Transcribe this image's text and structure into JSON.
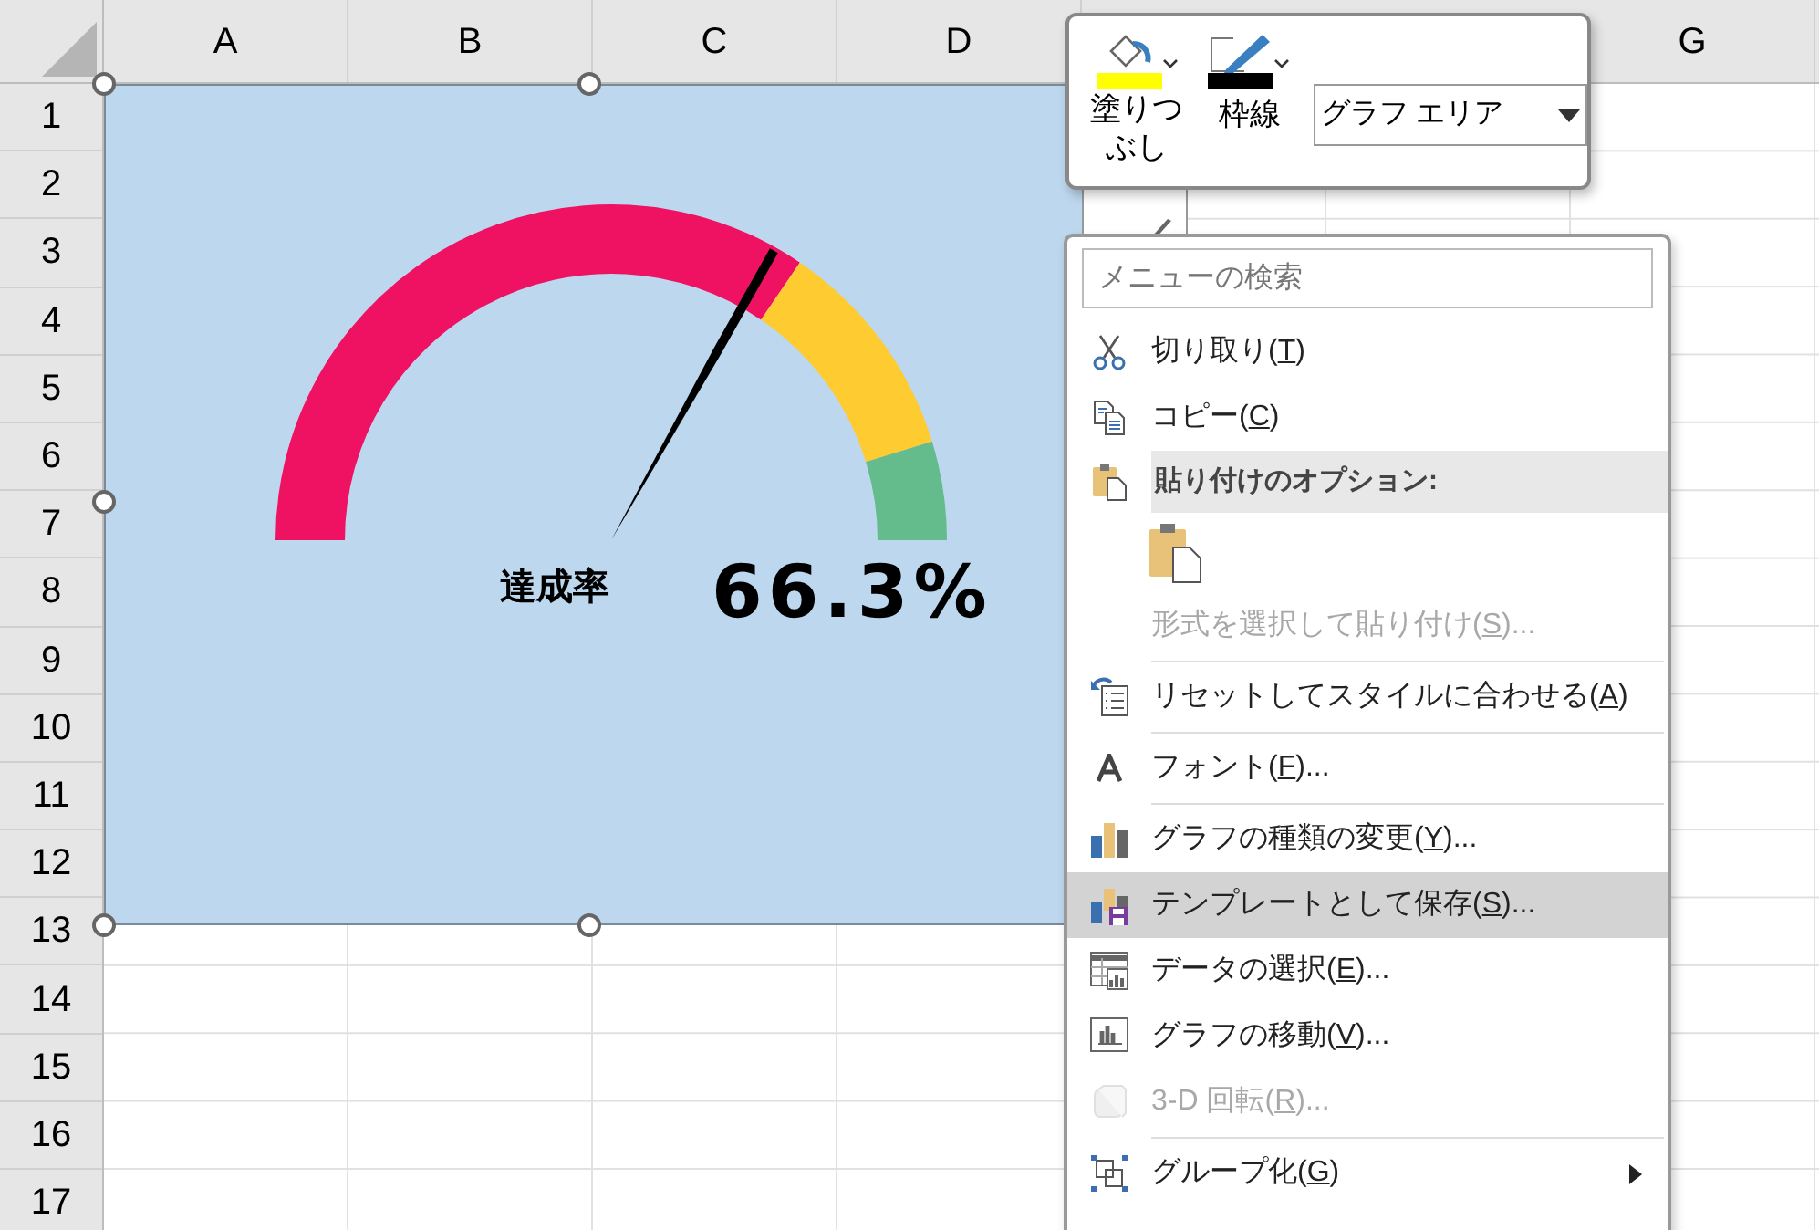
{
  "sheet": {
    "columns": [
      "A",
      "B",
      "C",
      "D",
      "G"
    ],
    "rows": [
      "1",
      "2",
      "3",
      "4",
      "5",
      "6",
      "7",
      "8",
      "9",
      "10",
      "11",
      "12",
      "13",
      "14",
      "15",
      "16",
      "17"
    ]
  },
  "chart": {
    "gauge": {
      "level": 0.663
    },
    "label": "達成率",
    "value": "66.3%"
  },
  "mini_toolbar": {
    "buttons": [
      {
        "kind": "fill",
        "label": "塗りつぶし",
        "color": "#ffff00"
      },
      {
        "kind": "outline",
        "label": "枠線",
        "color": "#000000"
      }
    ],
    "dropdown": {
      "value": "グラフ エリア"
    }
  },
  "context_menu": {
    "search": {
      "placeholder": "メニューの検索"
    },
    "items": [
      {
        "kind": "item",
        "text": "切り取り(",
        "accel": "T",
        "tail": ")",
        "disabled": false,
        "selected": false,
        "submenu": false
      },
      {
        "kind": "item",
        "text": "コピー(",
        "accel": "C",
        "tail": ")",
        "disabled": false,
        "selected": false,
        "submenu": false
      },
      {
        "kind": "header",
        "text": "貼り付けのオプション:"
      },
      {
        "kind": "paste-icons"
      },
      {
        "kind": "item",
        "text": "形式を選択して貼り付け(",
        "accel": "S",
        "tail": ")...",
        "disabled": true,
        "selected": false,
        "submenu": false
      },
      {
        "kind": "separator"
      },
      {
        "kind": "item",
        "text": "リセットしてスタイルに合わせる(",
        "accel": "A",
        "tail": ")",
        "disabled": false,
        "selected": false,
        "submenu": false
      },
      {
        "kind": "separator"
      },
      {
        "kind": "item",
        "text": "フォント(",
        "accel": "F",
        "tail": ")...",
        "disabled": false,
        "selected": false,
        "submenu": false
      },
      {
        "kind": "separator"
      },
      {
        "kind": "item",
        "text": "グラフの種類の変更(",
        "accel": "Y",
        "tail": ")...",
        "disabled": false,
        "selected": false,
        "submenu": false
      },
      {
        "kind": "item",
        "text": "テンプレートとして保存(",
        "accel": "S",
        "tail": ")...",
        "disabled": false,
        "selected": true,
        "submenu": false
      },
      {
        "kind": "item",
        "text": "データの選択(",
        "accel": "E",
        "tail": ")...",
        "disabled": false,
        "selected": false,
        "submenu": false
      },
      {
        "kind": "item",
        "text": "グラフの移動(",
        "accel": "V",
        "tail": ")...",
        "disabled": false,
        "selected": false,
        "submenu": false
      },
      {
        "kind": "item",
        "text": "3-D 回転(",
        "accel": "R",
        "tail": ")...",
        "disabled": true,
        "selected": false,
        "submenu": false
      },
      {
        "kind": "separator"
      },
      {
        "kind": "item",
        "text": "グループ化(",
        "accel": "G",
        "tail": ")",
        "disabled": false,
        "selected": false,
        "submenu": true
      }
    ]
  }
}
